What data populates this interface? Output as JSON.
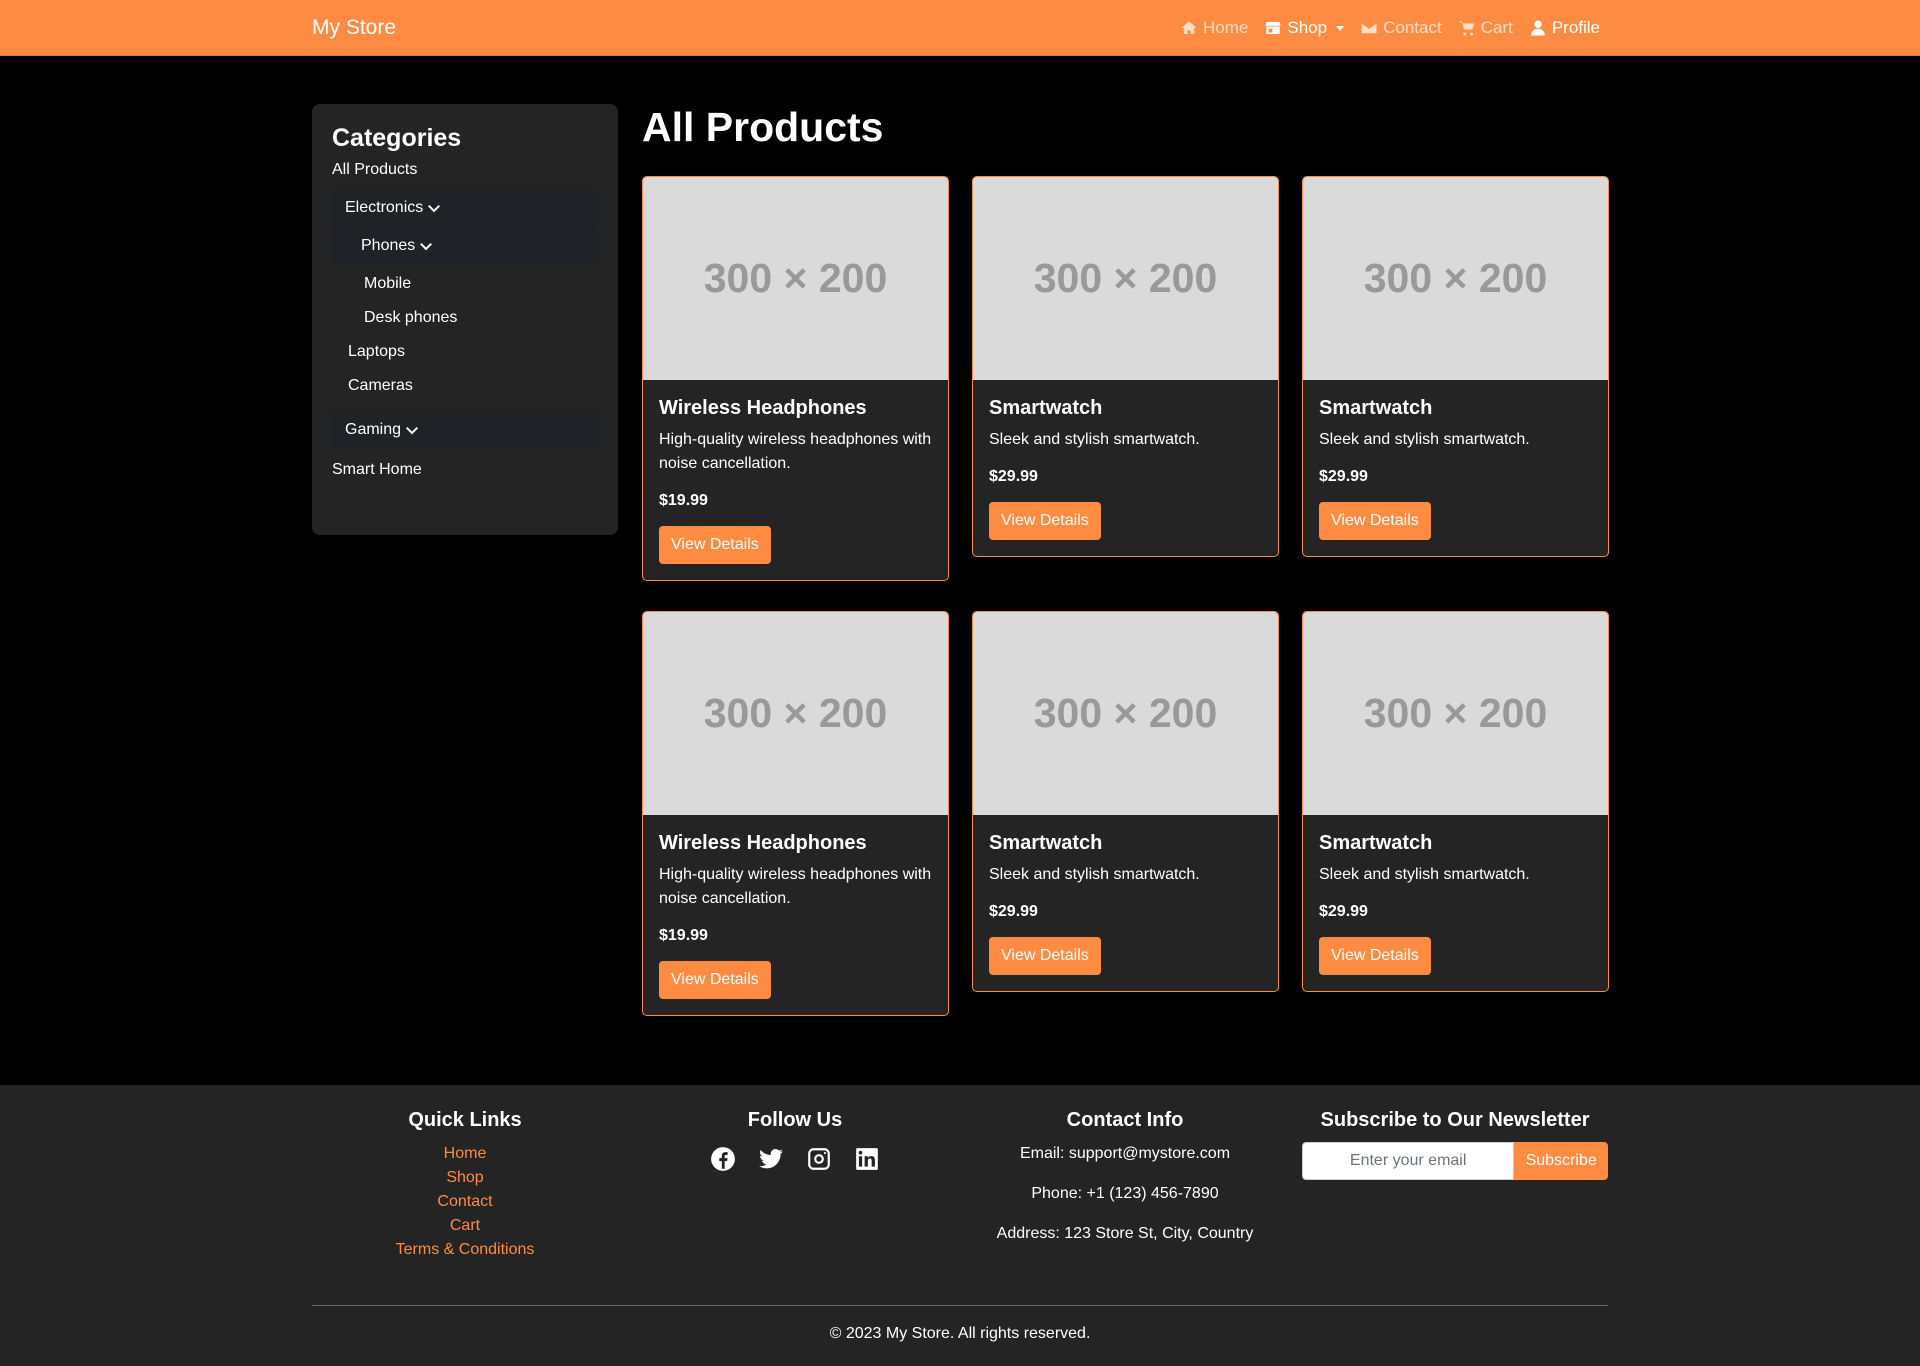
{
  "navbar": {
    "brand": "My Store",
    "items": [
      {
        "label": "Home",
        "icon": "home-icon"
      },
      {
        "label": "Shop",
        "icon": "store-icon"
      },
      {
        "label": "Contact",
        "icon": "envelope-icon"
      },
      {
        "label": "Cart",
        "icon": "cart-icon"
      },
      {
        "label": "Profile",
        "icon": "user-icon"
      }
    ]
  },
  "sidebar": {
    "title": "Categories",
    "all_products": "All Products",
    "electronics": "Electronics",
    "phones": "Phones",
    "mobile": "Mobile",
    "desk_phones": "Desk phones",
    "laptops": "Laptops",
    "cameras": "Cameras",
    "gaming": "Gaming",
    "smart_home": "Smart Home"
  },
  "main": {
    "title": "All Products",
    "products": [
      {
        "image": "300 × 200",
        "name": "Wireless Headphones",
        "desc": "High-quality wireless headphones with noise cancellation.",
        "price": "$19.99",
        "button": "View Details"
      },
      {
        "image": "300 × 200",
        "name": "Smartwatch",
        "desc": "Sleek and stylish smartwatch.",
        "price": "$29.99",
        "button": "View Details"
      },
      {
        "image": "300 × 200",
        "name": "Smartwatch",
        "desc": "Sleek and stylish smartwatch.",
        "price": "$29.99",
        "button": "View Details"
      },
      {
        "image": "300 × 200",
        "name": "Wireless Headphones",
        "desc": "High-quality wireless headphones with noise cancellation.",
        "price": "$19.99",
        "button": "View Details"
      },
      {
        "image": "300 × 200",
        "name": "Smartwatch",
        "desc": "Sleek and stylish smartwatch.",
        "price": "$29.99",
        "button": "View Details"
      },
      {
        "image": "300 × 200",
        "name": "Smartwatch",
        "desc": "Sleek and stylish smartwatch.",
        "price": "$29.99",
        "button": "View Details"
      }
    ]
  },
  "footer": {
    "quick_links": {
      "title": "Quick Links",
      "links": [
        "Home",
        "Shop",
        "Contact",
        "Cart",
        "Terms & Conditions"
      ]
    },
    "follow": {
      "title": "Follow Us",
      "icons": [
        "facebook-icon",
        "twitter-icon",
        "instagram-icon",
        "linkedin-icon"
      ]
    },
    "contact": {
      "title": "Contact Info",
      "email": "Email: support@mystore.com",
      "phone": "Phone: +1 (123) 456-7890",
      "address": "Address: 123 Store St, City, Country"
    },
    "newsletter": {
      "title": "Subscribe to Our Newsletter",
      "placeholder": "Enter your email",
      "button": "Subscribe"
    },
    "copyright": "© 2023 My Store. All rights reserved."
  },
  "colors": {
    "accent": "#fd8c42",
    "panel": "#242424",
    "background": "#000000"
  }
}
